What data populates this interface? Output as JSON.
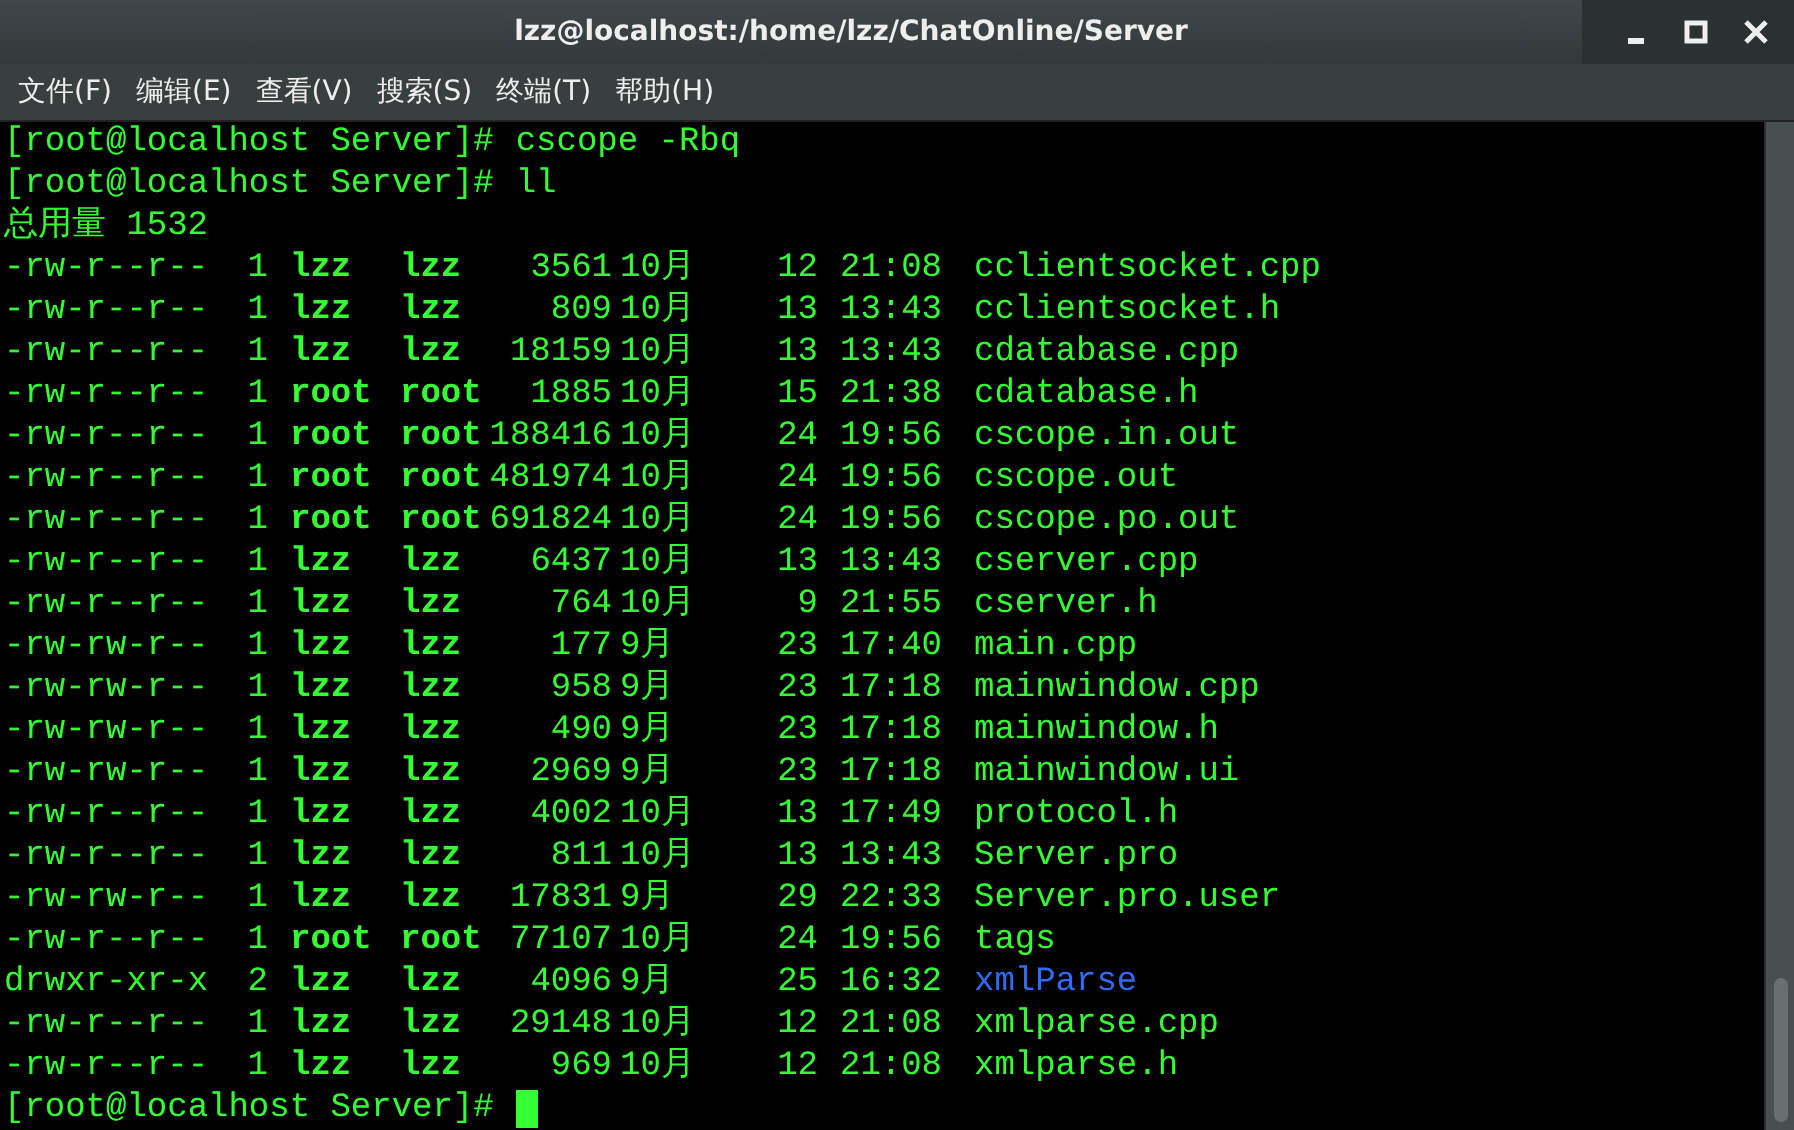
{
  "window": {
    "title": "lzz@localhost:/home/lzz/ChatOnline/Server"
  },
  "menu": [
    "文件(F)",
    "编辑(E)",
    "查看(V)",
    "搜索(S)",
    "终端(T)",
    "帮助(H)"
  ],
  "terminal": {
    "commands": [
      {
        "prompt": "[root@localhost Server]#",
        "command": "cscope -Rbq"
      },
      {
        "prompt": "[root@localhost Server]#",
        "command": "ll"
      }
    ],
    "total": "总用量 1532",
    "rows": [
      {
        "kind": "file",
        "perms": "-rw-r--r--",
        "links": "1",
        "owner": "lzz",
        "group": "lzz",
        "size": "3561",
        "month": "10月",
        "day": "12",
        "time": "21:08",
        "name": "cclientsocket.cpp"
      },
      {
        "kind": "file",
        "perms": "-rw-r--r--",
        "links": "1",
        "owner": "lzz",
        "group": "lzz",
        "size": "809",
        "month": "10月",
        "day": "13",
        "time": "13:43",
        "name": "cclientsocket.h"
      },
      {
        "kind": "file",
        "perms": "-rw-r--r--",
        "links": "1",
        "owner": "lzz",
        "group": "lzz",
        "size": "18159",
        "month": "10月",
        "day": "13",
        "time": "13:43",
        "name": "cdatabase.cpp"
      },
      {
        "kind": "file",
        "perms": "-rw-r--r--",
        "links": "1",
        "owner": "root",
        "group": "root",
        "size": "1885",
        "month": "10月",
        "day": "15",
        "time": "21:38",
        "name": "cdatabase.h"
      },
      {
        "kind": "file",
        "perms": "-rw-r--r--",
        "links": "1",
        "owner": "root",
        "group": "root",
        "size": "188416",
        "month": "10月",
        "day": "24",
        "time": "19:56",
        "name": "cscope.in.out"
      },
      {
        "kind": "file",
        "perms": "-rw-r--r--",
        "links": "1",
        "owner": "root",
        "group": "root",
        "size": "481974",
        "month": "10月",
        "day": "24",
        "time": "19:56",
        "name": "cscope.out"
      },
      {
        "kind": "file",
        "perms": "-rw-r--r--",
        "links": "1",
        "owner": "root",
        "group": "root",
        "size": "691824",
        "month": "10月",
        "day": "24",
        "time": "19:56",
        "name": "cscope.po.out"
      },
      {
        "kind": "file",
        "perms": "-rw-r--r--",
        "links": "1",
        "owner": "lzz",
        "group": "lzz",
        "size": "6437",
        "month": "10月",
        "day": "13",
        "time": "13:43",
        "name": "cserver.cpp"
      },
      {
        "kind": "file",
        "perms": "-rw-r--r--",
        "links": "1",
        "owner": "lzz",
        "group": "lzz",
        "size": "764",
        "month": "10月",
        "day": "9",
        "time": "21:55",
        "name": "cserver.h"
      },
      {
        "kind": "file",
        "perms": "-rw-rw-r--",
        "links": "1",
        "owner": "lzz",
        "group": "lzz",
        "size": "177",
        "month": "9月",
        "day": "23",
        "time": "17:40",
        "name": "main.cpp"
      },
      {
        "kind": "file",
        "perms": "-rw-rw-r--",
        "links": "1",
        "owner": "lzz",
        "group": "lzz",
        "size": "958",
        "month": "9月",
        "day": "23",
        "time": "17:18",
        "name": "mainwindow.cpp"
      },
      {
        "kind": "file",
        "perms": "-rw-rw-r--",
        "links": "1",
        "owner": "lzz",
        "group": "lzz",
        "size": "490",
        "month": "9月",
        "day": "23",
        "time": "17:18",
        "name": "mainwindow.h"
      },
      {
        "kind": "file",
        "perms": "-rw-rw-r--",
        "links": "1",
        "owner": "lzz",
        "group": "lzz",
        "size": "2969",
        "month": "9月",
        "day": "23",
        "time": "17:18",
        "name": "mainwindow.ui"
      },
      {
        "kind": "file",
        "perms": "-rw-r--r--",
        "links": "1",
        "owner": "lzz",
        "group": "lzz",
        "size": "4002",
        "month": "10月",
        "day": "13",
        "time": "17:49",
        "name": "protocol.h"
      },
      {
        "kind": "file",
        "perms": "-rw-r--r--",
        "links": "1",
        "owner": "lzz",
        "group": "lzz",
        "size": "811",
        "month": "10月",
        "day": "13",
        "time": "13:43",
        "name": "Server.pro"
      },
      {
        "kind": "file",
        "perms": "-rw-rw-r--",
        "links": "1",
        "owner": "lzz",
        "group": "lzz",
        "size": "17831",
        "month": "9月",
        "day": "29",
        "time": "22:33",
        "name": "Server.pro.user"
      },
      {
        "kind": "file",
        "perms": "-rw-r--r--",
        "links": "1",
        "owner": "root",
        "group": "root",
        "size": "77107",
        "month": "10月",
        "day": "24",
        "time": "19:56",
        "name": "tags"
      },
      {
        "kind": "dir",
        "perms": "drwxr-xr-x",
        "links": "2",
        "owner": "lzz",
        "group": "lzz",
        "size": "4096",
        "month": "9月",
        "day": "25",
        "time": "16:32",
        "name": "xmlParse"
      },
      {
        "kind": "file",
        "perms": "-rw-r--r--",
        "links": "1",
        "owner": "lzz",
        "group": "lzz",
        "size": "29148",
        "month": "10月",
        "day": "12",
        "time": "21:08",
        "name": "xmlparse.cpp"
      },
      {
        "kind": "file",
        "perms": "-rw-r--r--",
        "links": "1",
        "owner": "lzz",
        "group": "lzz",
        "size": "969",
        "month": "10月",
        "day": "12",
        "time": "21:08",
        "name": "xmlparse.h"
      }
    ],
    "final_prompt": "[root@localhost Server]#"
  }
}
